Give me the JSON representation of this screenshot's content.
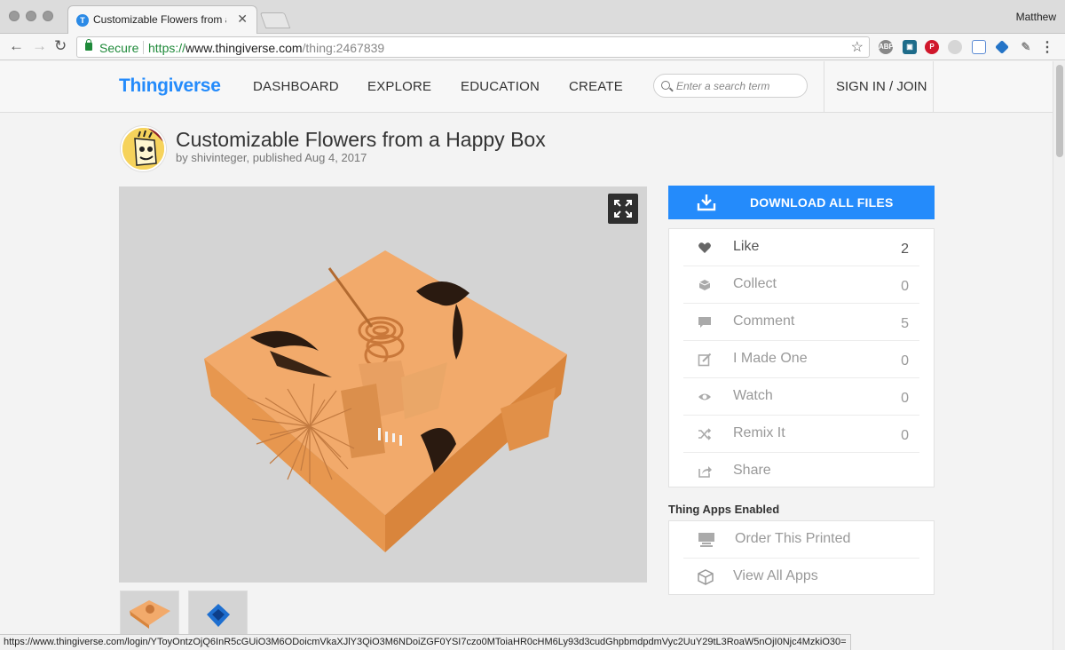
{
  "browser": {
    "tab_title": "Customizable Flowers from a Happy Box",
    "profile_name": "Matthew",
    "secure_label": "Secure",
    "url_scheme": "https://",
    "url_host": "www.thingiverse.com",
    "url_path": "/thing:2467839",
    "status_url": "https://www.thingiverse.com/login/YToyOntzOjQ6InR5cGUiO3M6ODoicmVkaXJlY3QiO3M6NDoiZGF0YSI7czo0MToiaHR0cHM6Ly93d3cudGhpbmdpdmVyc2UuY29tL3RoaW5nOjI0Njc4MzkiO30="
  },
  "header": {
    "logo": "Thingiverse",
    "nav": [
      "DASHBOARD",
      "EXPLORE",
      "EDUCATION",
      "CREATE"
    ],
    "search_placeholder": "Enter a search term",
    "signin": "SIGN IN / JOIN"
  },
  "thing": {
    "title": "Customizable Flowers from a Happy Box",
    "byline": "by shivinteger, published Aug 4, 2017"
  },
  "sidebar": {
    "download_label": "DOWNLOAD ALL FILES",
    "actions": [
      {
        "label": "Like",
        "count": "2",
        "icon": "heart-icon"
      },
      {
        "label": "Collect",
        "count": "0",
        "icon": "collect-icon"
      },
      {
        "label": "Comment",
        "count": "5",
        "icon": "comment-icon"
      },
      {
        "label": "I Made One",
        "count": "0",
        "icon": "made-one-icon"
      },
      {
        "label": "Watch",
        "count": "0",
        "icon": "eye-icon"
      },
      {
        "label": "Remix It",
        "count": "0",
        "icon": "shuffle-icon"
      },
      {
        "label": "Share",
        "count": "",
        "icon": "share-icon"
      }
    ],
    "apps_heading": "Thing Apps Enabled",
    "apps": [
      {
        "label": "Order This Printed",
        "icon": "printer-icon"
      },
      {
        "label": "View All Apps",
        "icon": "cube-icon"
      }
    ]
  },
  "colors": {
    "brand_blue": "#248bfb",
    "model_orange": "#f2aa6b"
  }
}
